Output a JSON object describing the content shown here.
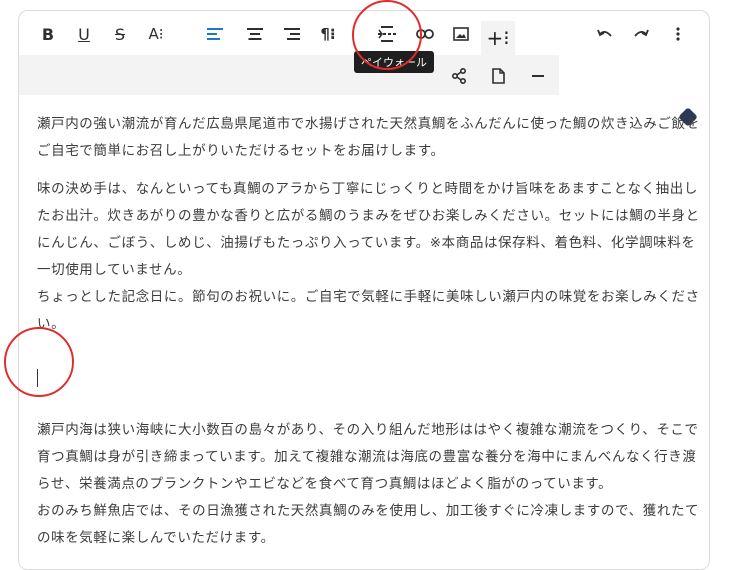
{
  "toolbar": {
    "buttons": [
      {
        "name": "bold-button",
        "icon": "bold-icon"
      },
      {
        "name": "underline-button",
        "icon": "underline-icon"
      },
      {
        "name": "strikethrough-button",
        "icon": "strikethrough-icon"
      },
      {
        "name": "font-size-button",
        "icon": "font-size-icon"
      },
      {
        "name": "align-left-button",
        "icon": "align-left-icon"
      },
      {
        "name": "align-center-button",
        "icon": "align-center-icon"
      },
      {
        "name": "align-right-button",
        "icon": "align-right-icon"
      },
      {
        "name": "paragraph-button",
        "icon": "paragraph-icon"
      },
      {
        "name": "paywall-button",
        "icon": "paywall-icon"
      },
      {
        "name": "link-button",
        "icon": "link-icon"
      },
      {
        "name": "image-button",
        "icon": "image-icon"
      },
      {
        "name": "insert-menu-button",
        "icon": "plus-icon"
      },
      {
        "name": "undo-button",
        "icon": "undo-icon"
      },
      {
        "name": "redo-button",
        "icon": "redo-icon"
      },
      {
        "name": "more-button",
        "icon": "more-vertical-icon"
      }
    ],
    "bold_label": "B",
    "underline_label": "U",
    "strike_label": "S",
    "fontsize_label": "A⁝",
    "paragraph_label": "¶⁝",
    "plus_label": "+⁝",
    "active_color": "#1e79c9"
  },
  "tooltip": "ペイウォール",
  "subbar": {
    "buttons": [
      "share-icon",
      "document-icon",
      "minus-icon"
    ]
  },
  "content": {
    "p1": [
      "瀬戸内の強い潮流が育んだ広島県尾道市で水揚げされた天然真鯛をふんだんに使った鯛の炊き込みご飯を",
      "ご自宅で簡単にお召し上がりいただけるセットをお届けします。"
    ],
    "p2": [
      "味の決め手は、なんといっても真鯛のアラから丁寧にじっくりと時間をかけ旨味をあますことなく抽出し",
      "たお出汁。炊きあがりの豊かな香りと広がる鯛のうまみをぜひお楽しみください。セットには鯛の半身と",
      "にんじん、ごぼう、しめじ、油揚げもたっぷり入っています。※本商品は保存料、着色料、化学調味料を",
      "一切使用していません。",
      "ちょっとした記念日に。節句のお祝いに。ご自宅で気軽に手軽に美味しい瀬戸内の味覚をお楽しみくださ",
      "い。"
    ],
    "p3": [
      "瀬戸内海は狭い海峡に大小数百の島々があり、その入り組んだ地形ははやく複雑な潮流をつくり、そこで",
      "育つ真鯛は身が引き締まっています。加えて複雑な潮流は海底の豊富な養分を海中にまんべんなく行き渡",
      "らせ、栄養満点のプランクトンやエビなどを食べて育つ真鯛はほどよく脂がのっています。",
      "おのみち鮮魚店では、その日漁獲された天然真鯛のみを使用し、加工後すぐに冷凍しますので、獲れたて",
      "の味を気軽に楽しんでいただけます。"
    ]
  },
  "highlight_color": "#e32b2b"
}
